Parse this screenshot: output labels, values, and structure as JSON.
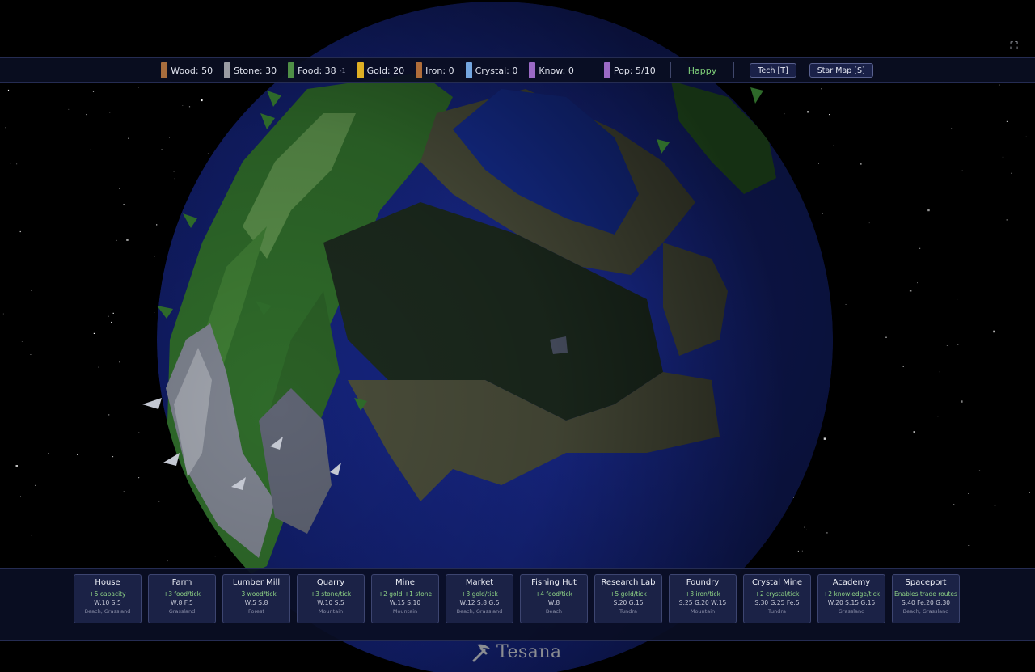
{
  "game": {
    "name": "Tesana"
  },
  "toolbar": {
    "resources": [
      {
        "id": "wood",
        "label": "Wood: 50",
        "delta": "",
        "color": "#a86d3d"
      },
      {
        "id": "stone",
        "label": "Stone: 30",
        "delta": "",
        "color": "#9a9ca2"
      },
      {
        "id": "food",
        "label": "Food: 38",
        "delta": "-1",
        "color": "#4f8f46"
      },
      {
        "id": "gold",
        "label": "Gold: 20",
        "delta": "",
        "color": "#e0b024"
      },
      {
        "id": "iron",
        "label": "Iron: 0",
        "delta": "",
        "color": "#b06d3a"
      },
      {
        "id": "crystal",
        "label": "Crystal: 0",
        "delta": "",
        "color": "#74a6e0"
      },
      {
        "id": "knowledge",
        "label": "Know: 0",
        "delta": "",
        "color": "#9b6ac6"
      }
    ],
    "population": {
      "label": "Pop: 5/10",
      "color": "#9b6ac6"
    },
    "mood": {
      "label": "Happy",
      "color": "#7fd07a"
    },
    "tech_button": "Tech [T]",
    "star_map_button": "Star Map [S]",
    "fullscreen_icon": "fullscreen-expand-icon"
  },
  "buildings": [
    {
      "name": "House",
      "effect": "+5 capacity",
      "cost": "W:10 S:5",
      "terrain": "Beach, Grassland"
    },
    {
      "name": "Farm",
      "effect": "+3 food/tick",
      "cost": "W:8 F:5",
      "terrain": "Grassland"
    },
    {
      "name": "Lumber Mill",
      "effect": "+3 wood/tick",
      "cost": "W:5 S:8",
      "terrain": "Forest"
    },
    {
      "name": "Quarry",
      "effect": "+3 stone/tick",
      "cost": "W:10 S:5",
      "terrain": "Mountain"
    },
    {
      "name": "Mine",
      "effect": "+2 gold +1 stone",
      "cost": "W:15 S:10",
      "terrain": "Mountain"
    },
    {
      "name": "Market",
      "effect": "+3 gold/tick",
      "cost": "W:12 S:8 G:5",
      "terrain": "Beach, Grassland"
    },
    {
      "name": "Fishing Hut",
      "effect": "+4 food/tick",
      "cost": "W:8",
      "terrain": "Beach"
    },
    {
      "name": "Research Lab",
      "effect": "+5 gold/tick",
      "cost": "S:20 G:15",
      "terrain": "Tundra"
    },
    {
      "name": "Foundry",
      "effect": "+3 iron/tick",
      "cost": "S:25 G:20 W:15",
      "terrain": "Mountain"
    },
    {
      "name": "Crystal Mine",
      "effect": "+2 crystal/tick",
      "cost": "S:30 G:25 Fe:5",
      "terrain": "Tundra"
    },
    {
      "name": "Academy",
      "effect": "+2 knowledge/tick",
      "cost": "W:20 S:15 G:15",
      "terrain": "Grassland"
    },
    {
      "name": "Spaceport",
      "effect": "Enables trade routes",
      "cost": "S:40 Fe:20 G:30",
      "terrain": "Beach, Grassland"
    }
  ],
  "colors": {
    "space": "#000000",
    "ocean": "#1a2c8a",
    "land_green": "#2f6b2a",
    "land_sand": "#4a4d3a",
    "mountain": "#8e929c",
    "panel_bg": "#0a0e22",
    "card_bg": "#1b2246"
  }
}
